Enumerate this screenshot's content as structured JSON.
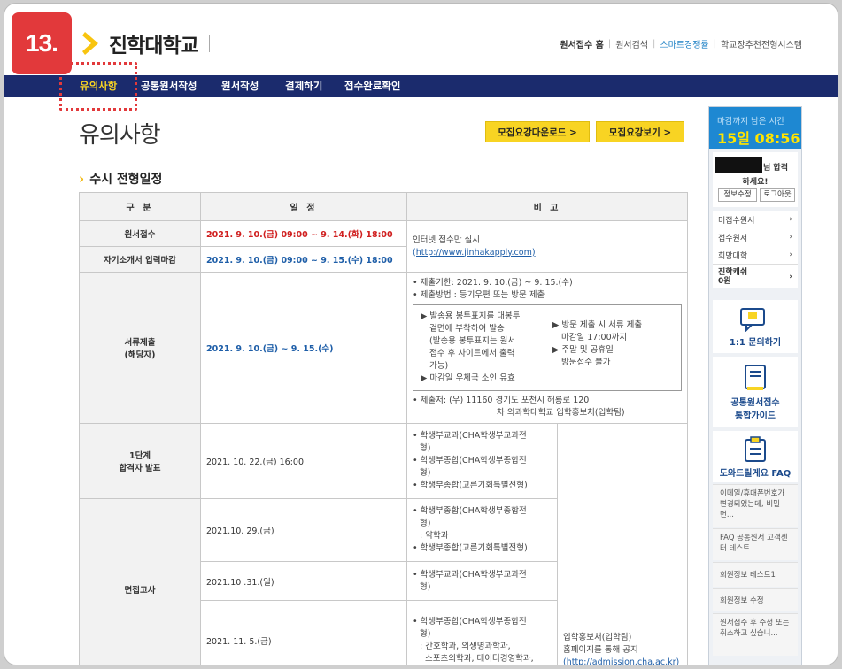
{
  "step": "13.",
  "logo": {
    "text": "진학대학교"
  },
  "top_links": [
    "원서접수 홈",
    "원서검색",
    "스마트경쟁률",
    "학교장추천전형시스템"
  ],
  "nav": {
    "items": [
      "유의사항",
      "공통원서작성",
      "원서작성",
      "결제하기",
      "접수완료확인"
    ],
    "active": "유의사항"
  },
  "page_title": "유의사항",
  "buttons": {
    "download": "모집요강다운로드 >",
    "view": "모집요강보기 >"
  },
  "section_title": "수시 전형일정",
  "table": {
    "headers": [
      "구 분",
      "일 정",
      "비 고"
    ],
    "rows": {
      "apply": {
        "label": "원서접수",
        "date": "2021. 9. 10.(금) 09:00 ~ 9. 14.(화) 18:00"
      },
      "intro": {
        "label": "자기소개서 입력마감",
        "date": "2021. 9. 10.(금) 09:00 ~ 9. 15.(수) 18:00"
      },
      "online_note": "인터넷 접수만 실시",
      "online_link": "(http://www.jinhakapply.com)",
      "docs": {
        "label1": "서류제출",
        "label2": "(해당자)",
        "date": "2021. 9. 10.(금) ~ 9. 15.(수)",
        "note1": "• 제출기한: 2021. 9. 10.(금) ~ 9. 15.(수)",
        "note2": "• 제출방법 : 등기우편 또는 방문 제출",
        "box_left": [
          "▶ 발송용 봉투표지를 대봉투",
          "겉면에 부착하여 발송",
          "(발송용 봉투표지는 원서",
          "접수 후 사이트에서 출력",
          "가능)",
          "▶ 마감일 우체국 소인 유효"
        ],
        "box_right": [
          "▶ 방문 제출 시 서류 제출",
          "마감일 17:00까지",
          "▶ 주말 및 공휴일",
          "방문접수 불가"
        ],
        "address1": "• 제출처: (우) 11160 경기도 포천시 해룡로 120",
        "address2": "차 의과학대학교 입학홍보처(입학팀)"
      },
      "stage1": {
        "label1": "1단계",
        "label2": "합격자 발표",
        "date": "2021. 10. 22.(금) 16:00",
        "notes": [
          "• 학생부교과(CHA학생부교과전",
          "형)",
          "• 학생부종합(CHA학생부종합전",
          "형)",
          "• 학생부종합(고른기회특별전형)"
        ]
      },
      "interview": {
        "label": "면접고사",
        "d1": "2021.10. 29.(금)",
        "n1": [
          "• 학생부종합(CHA학생부종합전",
          "형)",
          ": 약학과",
          "• 학생부종합(고른기회특별전형)"
        ],
        "d2": "2021.10 .31.(일)",
        "n2": [
          "• 학생부교과(CHA학생부교과전",
          "형)"
        ],
        "d3": "2021. 11. 5.(금)",
        "n3": [
          "• 학생부종합(CHA학생부종합전",
          "형)",
          ": 간호학과, 의생명과학과,",
          "스포츠의학과, 데이터경영학과,"
        ]
      },
      "announce": [
        "입학홍보처(입학팀)",
        "홈페이지를 통해 공지",
        "(http://admission.cha.ac.kr)"
      ]
    }
  },
  "sidebar": {
    "deadline_label": "마감까지 남은 시간",
    "deadline_value": "15일 08:56",
    "greet1": "님 합격",
    "greet2": "하세요!",
    "edit_info": "정보수정",
    "logout": "로그아웃",
    "menu": [
      "미접수원서",
      "접수원서",
      "희망대학"
    ],
    "cash_label": "진학캐쉬",
    "cash_value": "0원",
    "inquiry": "1:1 문의하기",
    "guide1": "공통원서접수",
    "guide2": "통합가이드",
    "faq_title": "도와드릴게요 FAQ",
    "faq": [
      "이메일/휴대폰번호가 변경되었는데, 비밀번...",
      "FAQ 공통원서 고객센터 테스트",
      "회원정보 테스트1",
      "회원정보 수정",
      "원서접수 후 수정 또는 취소하고 싶습니..."
    ]
  },
  "colors": {
    "nav": "#1b2b6d",
    "accent": "#f8d423",
    "badge": "#e2393b",
    "sidebar_blue": "#1e88d2"
  }
}
